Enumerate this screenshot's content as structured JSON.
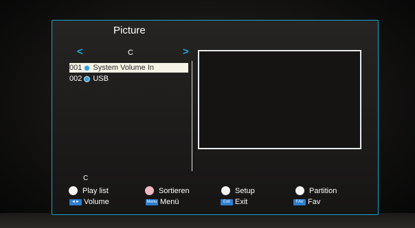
{
  "screen": {
    "title": "Picture",
    "nav": {
      "prev_glyph": "<",
      "next_glyph": ">"
    },
    "current_drive": "C",
    "files": [
      {
        "number": "001",
        "name": "System Volume In",
        "selected": true
      },
      {
        "number": "002",
        "name": "USB",
        "selected": false
      }
    ],
    "current_path": "C"
  },
  "legend": {
    "colored": [
      {
        "label": "Play list",
        "color": "#f4f4f4"
      },
      {
        "label": "Sortieren",
        "color": "#f2b7c4"
      },
      {
        "label": "Setup",
        "color": "#f4f4f4"
      },
      {
        "label": "Partition",
        "color": "#f4f4f4"
      }
    ],
    "keys": [
      {
        "key": "◄►",
        "label": "Volume"
      },
      {
        "key": "Menu",
        "label": "Menü"
      },
      {
        "key": "Exit",
        "label": "Exit"
      },
      {
        "key": "FAV",
        "label": "Fav"
      }
    ]
  },
  "colors": {
    "accent": "#18a6c8",
    "arrow": "#1ea7e6",
    "selection": "#f7f3e6",
    "key_badge": "#2c7fd1"
  }
}
